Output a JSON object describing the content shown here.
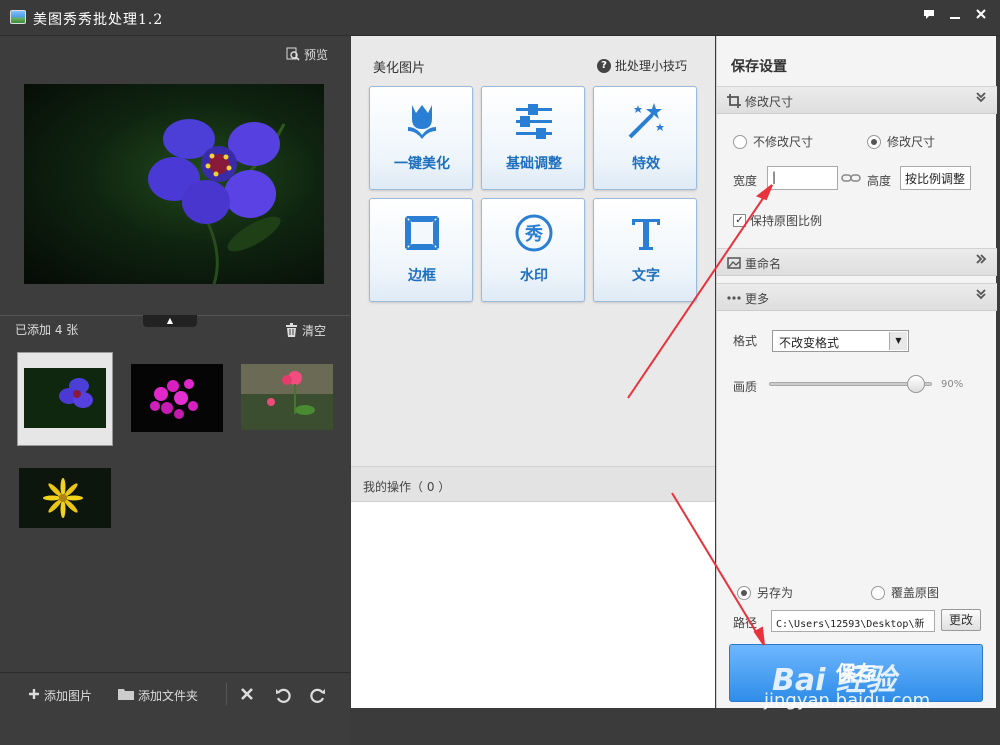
{
  "window": {
    "title": "美图秀秀批处理1.2"
  },
  "left": {
    "preview_label": "预览",
    "added_count": "已添加 4 张",
    "clear_label": "清空",
    "toolbar": {
      "add_image": "添加图片",
      "add_folder": "添加文件夹"
    }
  },
  "middle": {
    "header": "美化图片",
    "tips": "批处理小技巧",
    "tools": [
      {
        "label": "一键美化",
        "icon": "tulip-icon"
      },
      {
        "label": "基础调整",
        "icon": "sliders-icon"
      },
      {
        "label": "特效",
        "icon": "magic-wand-icon"
      },
      {
        "label": "边框",
        "icon": "frame-icon"
      },
      {
        "label": "水印",
        "icon": "watermark-stamp-icon"
      },
      {
        "label": "文字",
        "icon": "text-t-icon"
      }
    ],
    "ops_label": "我的操作（ 0 ）"
  },
  "right": {
    "title": "保存设置",
    "resize": {
      "section": "修改尺寸",
      "no_resize": "不修改尺寸",
      "resize": "修改尺寸",
      "selected": "resize",
      "width_label": "宽度",
      "width_value": "|",
      "height_label": "高度",
      "height_value": "按比例调整",
      "keep_ratio": "保持原图比例",
      "keep_ratio_checked": true
    },
    "rename": {
      "section": "重命名"
    },
    "more": {
      "section": "更多",
      "format_label": "格式",
      "format_value": "不改变格式",
      "quality_label": "画质",
      "quality_value": "90%",
      "quality_level": 0.9
    },
    "output": {
      "save_as": "另存为",
      "overwrite": "覆盖原图",
      "selected": "save_as",
      "path_label": "路径",
      "path_value": "C:\\Users\\12593\\Desktop\\新",
      "change_button": "更改"
    },
    "save_button": "保存"
  },
  "watermark": {
    "logo": "Bai 经验",
    "url": "jingyan.baidu.com"
  },
  "colors": {
    "accent": "#2f8de8",
    "tool_label": "#1e6fc0",
    "annotation": "#e8323c"
  }
}
